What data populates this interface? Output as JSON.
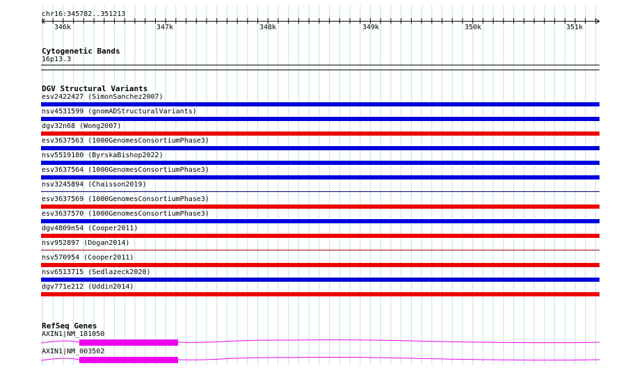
{
  "locus": "chr16:345782..351213",
  "ruler": {
    "ticks": [
      "346k",
      "347k",
      "348k",
      "349k",
      "350k",
      "351k"
    ]
  },
  "cytobands": {
    "title": "Cytogenetic Bands",
    "band": "16p13.3"
  },
  "dgv": {
    "title": "DGV Structural Variants",
    "variants": [
      {
        "label": "esv2422427 (SimonSanchez2007)",
        "color": "#0000dd"
      },
      {
        "label": "nsv4531599 (gnomADStructuralVariants)",
        "color": "#0000dd"
      },
      {
        "label": "dgv32n68 (Wong2007)",
        "color": "#ee0000"
      },
      {
        "label": "esv3637563 (1000GenomesConsortiumPhase3)",
        "color": "#0000dd"
      },
      {
        "label": "nsv5519180 (ByrskaBishop2022)",
        "color": "#0000dd"
      },
      {
        "label": "esv3637564 (1000GenomesConsortiumPhase3)",
        "color": "#0000dd"
      },
      {
        "label": "nsv3245894 (Chaisson2019)",
        "color": "#000077",
        "thin": true
      },
      {
        "label": "esv3637569 (1000GenomesConsortiumPhase3)",
        "color": "#ee0000"
      },
      {
        "label": "esv3637570 (1000GenomesConsortiumPhase3)",
        "color": "#0000dd"
      },
      {
        "label": "dgv4809n54 (Cooper2011)",
        "color": "#ee0000"
      },
      {
        "label": "nsv952897 (Dogan2014)",
        "color": "#990000",
        "thin": true
      },
      {
        "label": "nsv570954 (Cooper2011)",
        "color": "#ee0000"
      },
      {
        "label": "nsv6513715 (Sedlazeck2020)",
        "color": "#0000dd"
      },
      {
        "label": "dgv771e212 (Uddin2014)",
        "color": "#ee0000"
      }
    ]
  },
  "refseq": {
    "title": "RefSeq Genes",
    "genes": [
      {
        "label": "AXIN1|NM_181050",
        "color": "#ee00ee"
      },
      {
        "label": "AXIN1|NM_003502",
        "color": "#ee00ee"
      }
    ]
  }
}
